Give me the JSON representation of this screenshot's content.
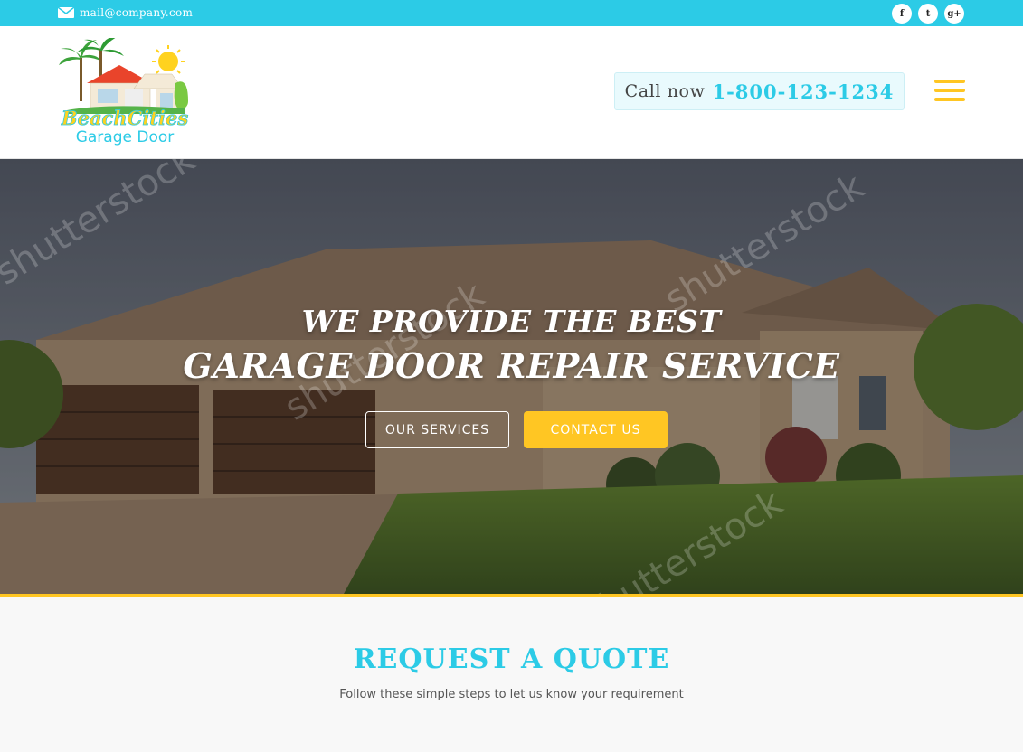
{
  "topbar": {
    "email": "mail@company.com",
    "socials": [
      {
        "icon": "facebook-icon",
        "glyph": "f"
      },
      {
        "icon": "twitter-icon",
        "glyph": "t"
      },
      {
        "icon": "google-plus-icon",
        "glyph": "g+"
      }
    ]
  },
  "header": {
    "logo_text_line1": "BeachCities",
    "logo_text_line2": "Garage Door",
    "call_label": "Call now",
    "call_number": "1-800-123-1234"
  },
  "hero": {
    "headline_line1": "WE PROVIDE THE BEST",
    "headline_line2": "GARAGE DOOR REPAIR SERVICE",
    "watermark": "shutterstock",
    "primary_button": "OUR SERVICES",
    "secondary_button": "CONTACT US"
  },
  "quote": {
    "title": "REQUEST A QUOTE",
    "subtitle": "Follow these simple steps to let us know your requirement"
  },
  "colors": {
    "accent_cyan": "#2ccbe6",
    "accent_yellow": "#ffc623"
  }
}
